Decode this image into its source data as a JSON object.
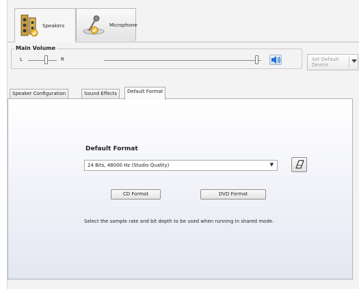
{
  "device_tabs": [
    {
      "label": "Speakers",
      "icon": "speaker-icon"
    },
    {
      "label": "Microphone",
      "icon": "microphone-icon"
    }
  ],
  "main_volume": {
    "title": "Main Volume",
    "balance_left": "L",
    "balance_right": "R",
    "level": 0.96,
    "speaker_icon": "speaker-volume-icon"
  },
  "set_default": {
    "label_line1": "Set Default",
    "label_line2": "Device"
  },
  "inner_tabs": [
    "Speaker Configuration",
    "Sound Effects",
    "Default Format"
  ],
  "default_format": {
    "title": "Default Format",
    "selected": "24 Bits, 48000 Hz (Studio Quality)",
    "cd_button": "CD Format",
    "dvd_button": "DVD Format",
    "description": "Select the sample rate and bit depth to be used when running in shared mode."
  },
  "colors": {
    "accent": "#1f6ed6"
  }
}
